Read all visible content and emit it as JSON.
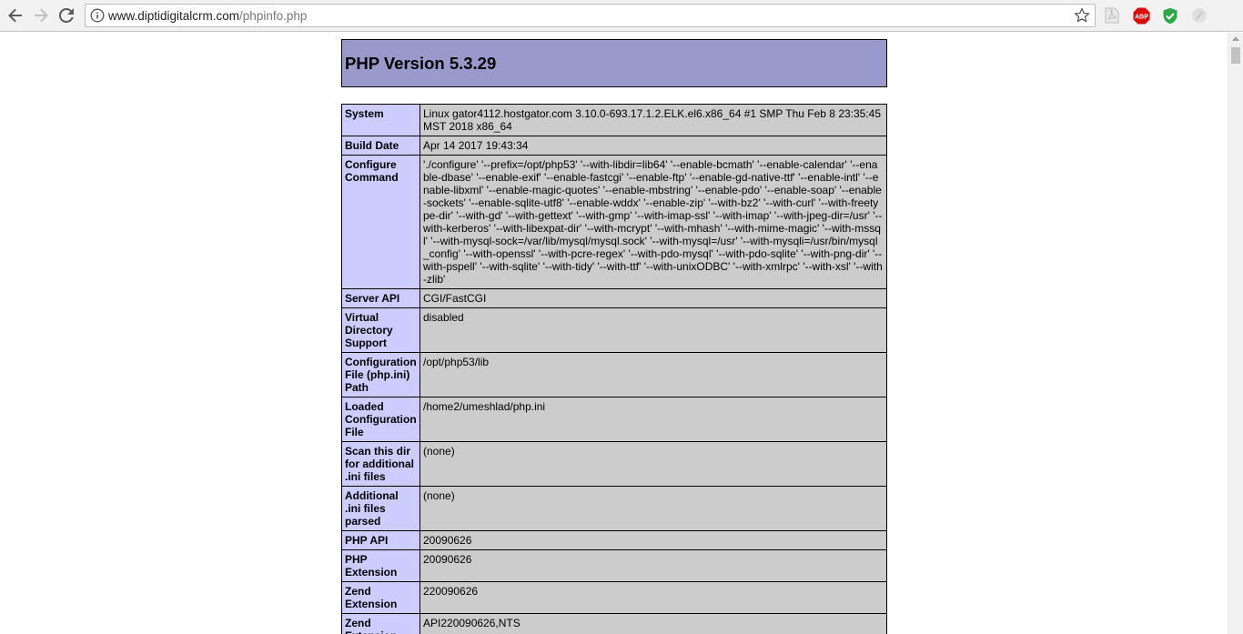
{
  "browser": {
    "url_host": "www.diptidigitalcrm.com",
    "url_path": "/phpinfo.php",
    "extensions": [
      {
        "name": "pdf-extension-icon"
      },
      {
        "name": "adblock-plus-icon",
        "label": "ABP"
      },
      {
        "name": "shield-extension-icon"
      },
      {
        "name": "feather-extension-icon"
      }
    ]
  },
  "page": {
    "title": "PHP Version 5.3.29",
    "rows": [
      {
        "key": "System",
        "value": "Linux gator4112.hostgator.com 3.10.0-693.17.1.2.ELK.el6.x86_64 #1 SMP Thu Feb 8 23:35:45 MST 2018 x86_64"
      },
      {
        "key": "Build Date",
        "value": "Apr 14 2017 19:43:34"
      },
      {
        "key": "Configure Command",
        "value": "'./configure' '--prefix=/opt/php53' '--with-libdir=lib64' '--enable-bcmath' '--enable-calendar' '--enable-dbase' '--enable-exif' '--enable-fastcgi' '--enable-ftp' '--enable-gd-native-ttf' '--enable-intl' '--enable-libxml' '--enable-magic-quotes' '--enable-mbstring' '--enable-pdo' '--enable-soap' '--enable-sockets' '--enable-sqlite-utf8' '--enable-wddx' '--enable-zip' '--with-bz2' '--with-curl' '--with-freetype-dir' '--with-gd' '--with-gettext' '--with-gmp' '--with-imap-ssl' '--with-imap' '--with-jpeg-dir=/usr' '--with-kerberos' '--with-libexpat-dir' '--with-mcrypt' '--with-mhash' '--with-mime-magic' '--with-mssql' '--with-mysql-sock=/var/lib/mysql/mysql.sock' '--with-mysql=/usr' '--with-mysqli=/usr/bin/mysql_config' '--with-openssl' '--with-pcre-regex' '--with-pdo-mysql' '--with-pdo-sqlite' '--with-png-dir' '--with-pspell' '--with-sqlite' '--with-tidy' '--with-ttf' '--with-unixODBC' '--with-xmlrpc' '--with-xsl' '--with-zlib'"
      },
      {
        "key": "Server API",
        "value": "CGI/FastCGI"
      },
      {
        "key": "Virtual Directory Support",
        "value": "disabled"
      },
      {
        "key": "Configuration File (php.ini) Path",
        "value": "/opt/php53/lib"
      },
      {
        "key": "Loaded Configuration File",
        "value": "/home2/umeshlad/php.ini"
      },
      {
        "key": "Scan this dir for additional .ini files",
        "value": "(none)"
      },
      {
        "key": "Additional .ini files parsed",
        "value": "(none)"
      },
      {
        "key": "PHP API",
        "value": "20090626"
      },
      {
        "key": "PHP Extension",
        "value": "20090626"
      },
      {
        "key": "Zend Extension",
        "value": "220090626"
      },
      {
        "key": "Zend Extension Build",
        "value": "API220090626,NTS"
      }
    ]
  },
  "colors": {
    "header_bg": "#9999cc",
    "key_bg": "#ccccff",
    "value_bg": "#cccccc"
  }
}
